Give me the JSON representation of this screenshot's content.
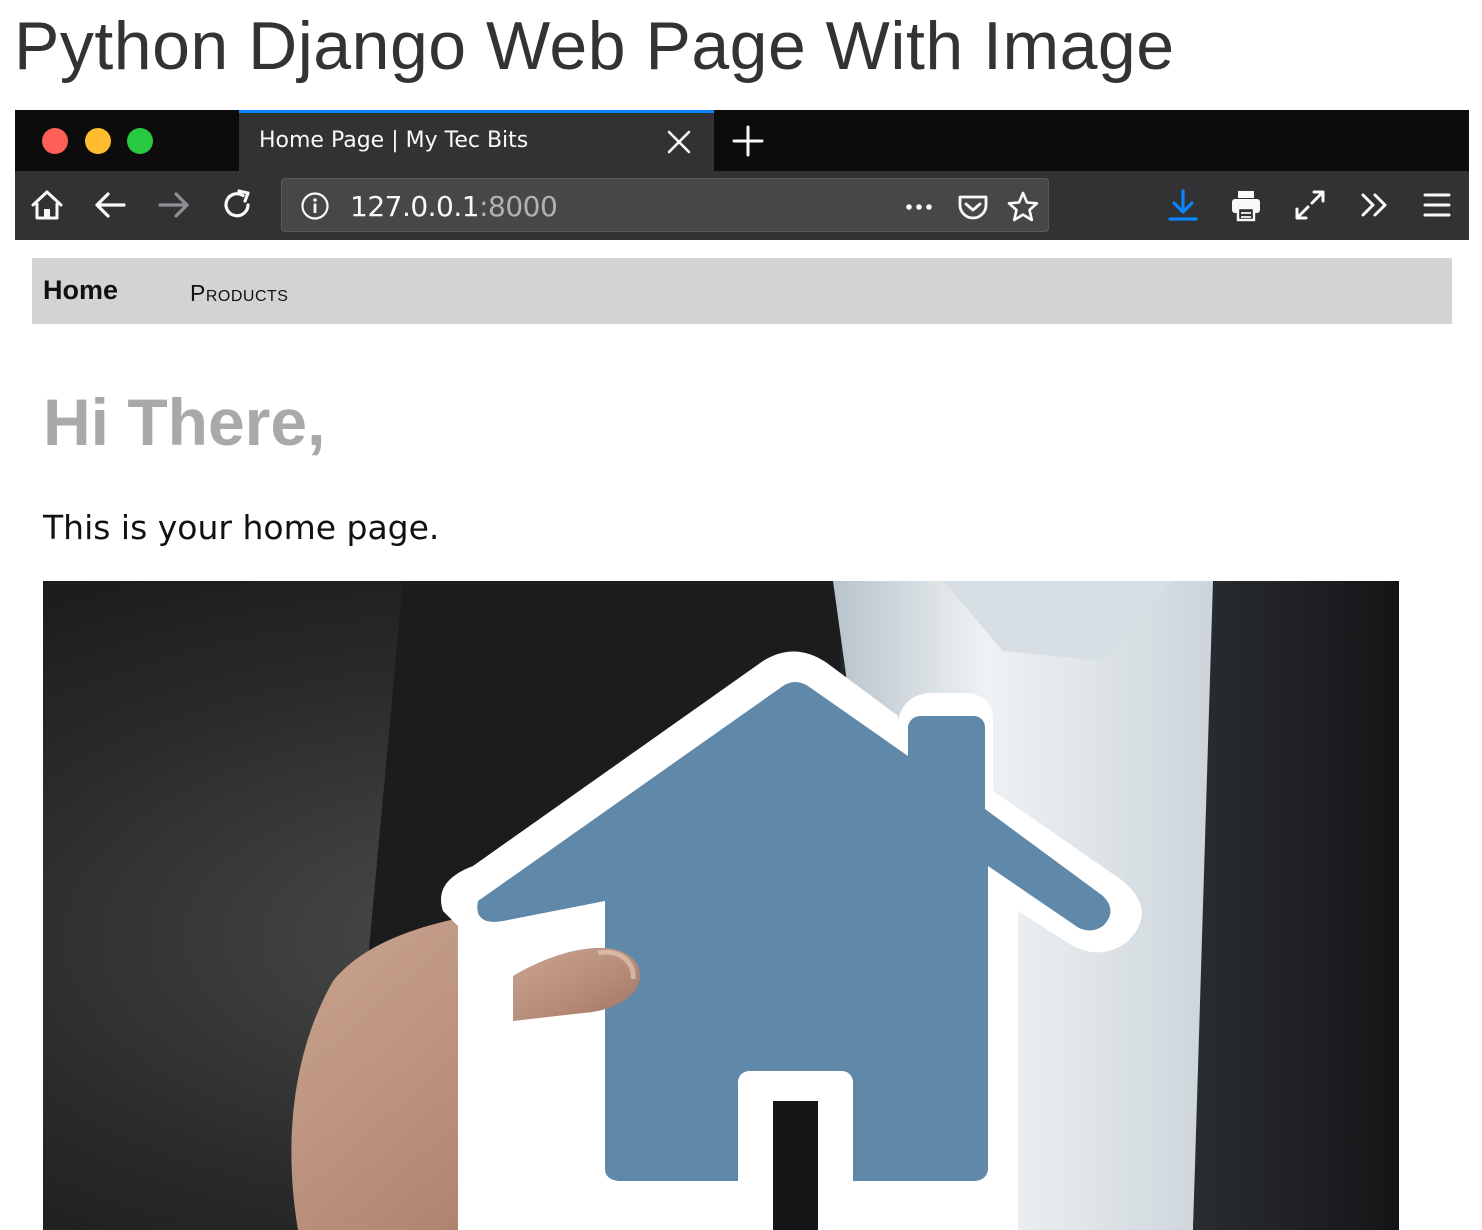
{
  "heading": "Python Django Web Page With Image",
  "browser": {
    "tab": {
      "title": "Home Page | My Tec Bits",
      "active_accent": "#0a84ff"
    },
    "url": {
      "host": "127.0.0.1",
      "port": ":8000"
    },
    "traffic_lights": [
      "#fe5f57",
      "#febc2e",
      "#28c840"
    ],
    "toolbar_icons": [
      "home-icon",
      "back-arrow-icon",
      "forward-arrow-icon",
      "reload-icon",
      "info-icon",
      "more-dots-icon",
      "pocket-icon",
      "star-icon",
      "download-icon",
      "print-icon",
      "fullscreen-icon",
      "overflow-chevron-icon",
      "hamburger-menu-icon"
    ]
  },
  "site": {
    "nav": {
      "home": "Home",
      "products": "Products"
    },
    "greeting": "Hi There,",
    "intro": "This is your home page.",
    "hero_image": {
      "subject": "hand-holding-house-icon",
      "house_color": "#6088a9"
    }
  }
}
